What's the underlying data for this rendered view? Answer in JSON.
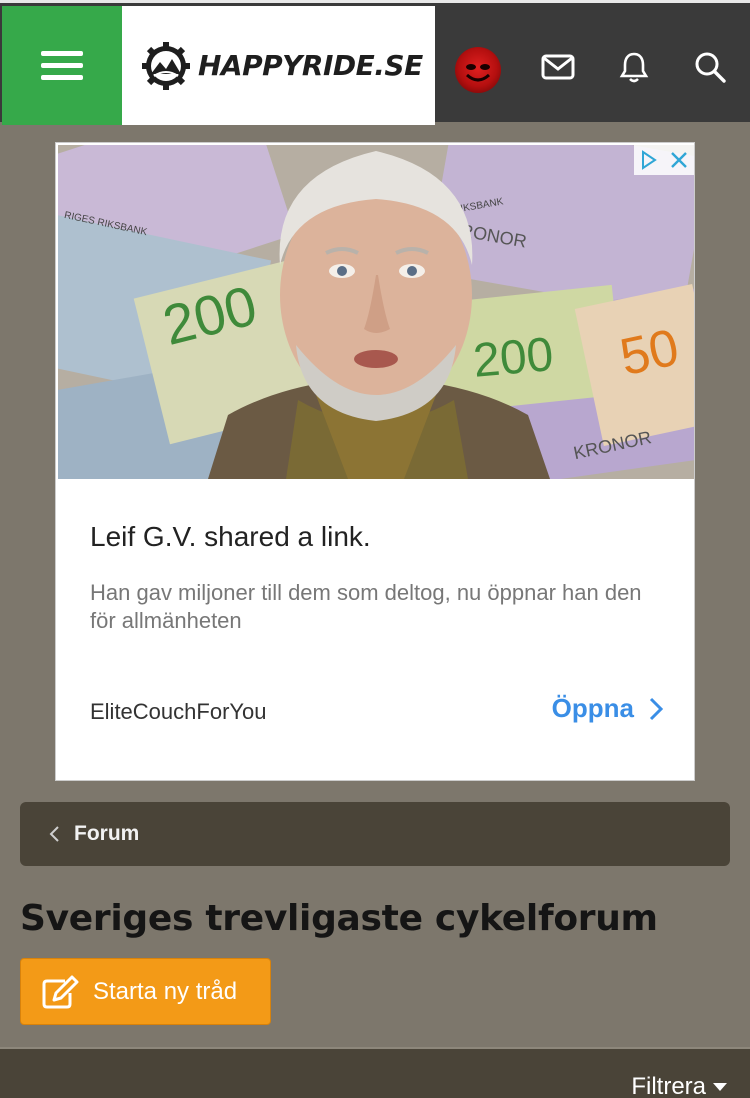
{
  "header": {
    "logo_text": "HAPPYRIDE.SE",
    "colors": {
      "menu_bg": "#36a94a",
      "header_bg": "#3a3a3a"
    },
    "icons": [
      "menu-icon",
      "avatar",
      "mail-icon",
      "bell-icon",
      "search-icon"
    ]
  },
  "ad": {
    "title": "Leif G.V. shared a link.",
    "description": "Han gav miljoner till dem som deltog, nu öppnar han den för allmänheten",
    "source": "EliteCouchForYou",
    "cta": "Öppna",
    "image_texts": {
      "note_200_a": "200",
      "note_200_b": "200",
      "note_500": "50",
      "kronor_a": "KRONOR",
      "kronor_b": "KRONOR",
      "riksbank_a": "RIGES RIKSBANK",
      "riksbank_b": "RIKSBANK"
    }
  },
  "breadcrumb": {
    "label": "Forum"
  },
  "page": {
    "title": "Sveriges trevligaste cykelforum",
    "new_thread_label": "Starta ny tråd",
    "filter_label": "Filtrera"
  }
}
